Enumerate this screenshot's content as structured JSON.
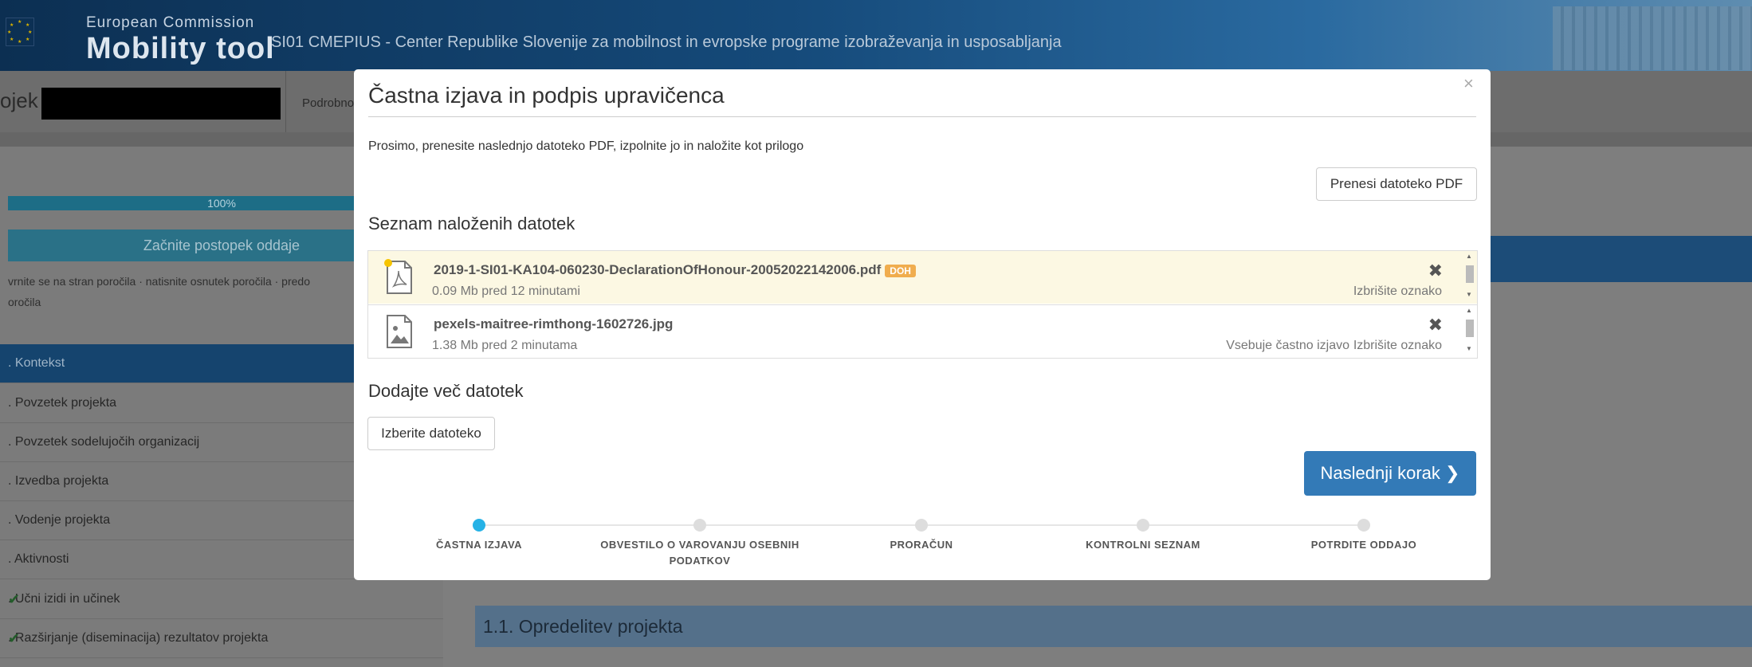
{
  "header": {
    "brand_top": "European Commission",
    "brand_main": "Mobility tool",
    "organisation": "SI01 CMEPIUS - Center Republike Slovenije za mobilnost in evropske programe izobraževanja in usposabljanja"
  },
  "project_bar": {
    "project_label": "ojek",
    "details_label": "Podrobno"
  },
  "sidebar": {
    "progress_text": "100%",
    "progress_value": 1.0,
    "start_button": "Začnite postopek oddaje",
    "links_line1": "vrnite se na stran poročila  ·  natisnite osnutek poročila  ·  predo",
    "links_line2": "oročila",
    "items": [
      {
        "label": ". Kontekst",
        "done": false,
        "active": true
      },
      {
        "label": ". Povzetek projekta",
        "done": false,
        "active": false
      },
      {
        "label": ". Povzetek sodelujočih organizacij",
        "done": false,
        "active": false
      },
      {
        "label": ". Izvedba projekta",
        "done": false,
        "active": false
      },
      {
        "label": ". Vodenje projekta",
        "done": false,
        "active": false
      },
      {
        "label": ". Aktivnosti",
        "done": false,
        "active": false
      },
      {
        "label": ". Učni izidi in učinek",
        "done": true,
        "active": false
      },
      {
        "label": ". Razširjanje (diseminacija) rezultatov projekta",
        "done": true,
        "active": false
      }
    ],
    "check_glyph": "✔"
  },
  "main": {
    "section_title": "1.1. Opredelitev projekta"
  },
  "modal": {
    "title": "Častna izjava in podpis upravičenca",
    "close_glyph": "×",
    "intro": "Prosimo, prenesite naslednjo datoteko PDF, izpolnite jo in naložite kot prilogo",
    "download_button": "Prenesi datoteko PDF",
    "list_title": "Seznam naloženih datotek",
    "files": [
      {
        "name": "2019-1-SI01-KA104-060230-DeclarationOfHonour-20052022142006.pdf",
        "badge": "DOH",
        "size": "0.09 Mb",
        "time": "pred 12 minutami",
        "honour": "",
        "remove_label": "Izbrišite oznako",
        "icon": "pdf-file-icon",
        "highlight": true
      },
      {
        "name": "pexels-maitree-rimthong-1602726.jpg",
        "badge": "",
        "size": "1.38 Mb",
        "time": "pred 2 minutama",
        "honour": "Vsebuje častno izjavo",
        "remove_label": "Izbrišite oznako",
        "icon": "image-file-icon",
        "highlight": false
      }
    ],
    "delete_glyph": "✖",
    "more_title": "Dodajte več datotek",
    "select_button": "Izberite datoteko",
    "next_button": "Naslednji korak",
    "next_glyph": "❯",
    "steps": [
      {
        "label": "ČASTNA IZJAVA",
        "active": true
      },
      {
        "label": "OBVESTILO O VAROVANJU OSEBNIH PODATKOV",
        "active": false
      },
      {
        "label": "PRORAČUN",
        "active": false
      },
      {
        "label": "KONTROLNI SEZNAM",
        "active": false
      },
      {
        "label": "POTRDITE ODDAJO",
        "active": false
      }
    ]
  }
}
